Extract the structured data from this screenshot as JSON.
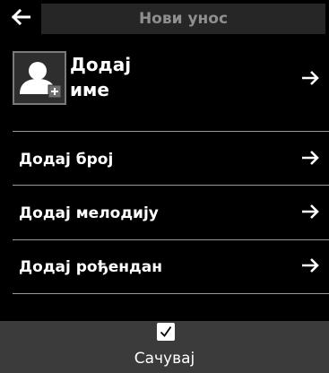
{
  "header": {
    "title": "Нови унос",
    "back_icon": "arrow-left-icon"
  },
  "contact": {
    "avatar_icon": "person-add-icon",
    "name_line1": "Додај",
    "name_line2": "име",
    "arrow_icon": "arrow-right-icon"
  },
  "items": [
    {
      "label": "Додај број",
      "icon": "arrow-right-icon"
    },
    {
      "label": "Додај мелодију",
      "icon": "arrow-right-icon"
    },
    {
      "label": "Додај рођендан",
      "icon": "arrow-right-icon"
    }
  ],
  "footer": {
    "check_icon": "checkmark-icon",
    "save_label": "Сачувај"
  },
  "colors": {
    "background": "#000000",
    "title_bar": "#262626",
    "title_text": "#8f8f8f",
    "footer": "#3b3b3b",
    "divider": "#9a9a9a"
  }
}
